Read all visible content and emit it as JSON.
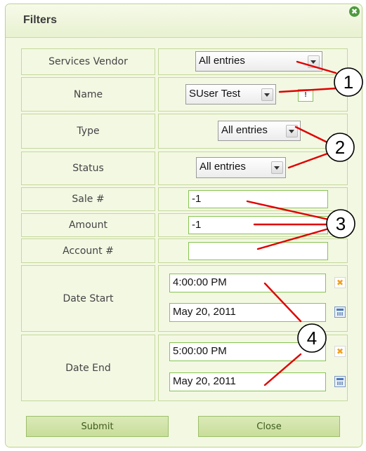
{
  "dialog": {
    "title": "Filters",
    "close_glyph": "✖"
  },
  "fields": {
    "services_vendor": {
      "label": "Services Vendor",
      "value": "All entries"
    },
    "name": {
      "label": "Name",
      "value": "SUser Test",
      "flag": "!"
    },
    "type": {
      "label": "Type",
      "value": "All entries"
    },
    "status": {
      "label": "Status",
      "value": "All entries"
    },
    "sale": {
      "label": "Sale #",
      "value": "-1"
    },
    "amount": {
      "label": "Amount",
      "value": "-1"
    },
    "account": {
      "label": "Account #",
      "value": ""
    },
    "date_start": {
      "label": "Date Start",
      "time": "4:00:00 PM",
      "date": "May 20, 2011"
    },
    "date_end": {
      "label": "Date End",
      "time": "5:00:00 PM",
      "date": "May 20, 2011"
    }
  },
  "buttons": {
    "submit": "Submit",
    "close": "Close"
  },
  "callouts": [
    "1",
    "2",
    "3",
    "4"
  ],
  "icons": {
    "clear": "✖",
    "calendar": "calendar-icon"
  },
  "colors": {
    "panel_background": "#f3f8e3",
    "border": "#c5d89a",
    "field_border": "#86c450",
    "annotation_line": "#e00000"
  }
}
